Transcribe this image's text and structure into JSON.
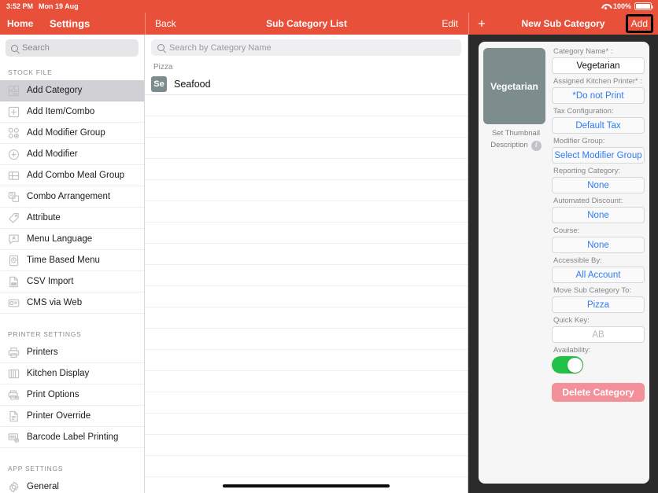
{
  "status": {
    "time": "3:52 PM",
    "date": "Mon 19 Aug",
    "battery_pct": "100%",
    "wifi_icon": "wifi-icon",
    "battery_icon": "battery-icon"
  },
  "nav": {
    "home": "Home",
    "settings": "Settings",
    "back": "Back",
    "list_title": "Sub Category List",
    "edit": "Edit",
    "detail_title": "New Sub Category",
    "add": "Add",
    "plus": "+",
    "accent": "#E8503A"
  },
  "sidebar": {
    "search_placeholder": "Search",
    "sections": [
      {
        "header": "STOCK FILE",
        "items": [
          {
            "label": "Add Category",
            "icon": "grid-add-icon",
            "selected": true
          },
          {
            "label": "Add Item/Combo",
            "icon": "plus-square-icon",
            "selected": false
          },
          {
            "label": "Add Modifier Group",
            "icon": "circles-add-icon",
            "selected": false
          },
          {
            "label": "Add Modifier",
            "icon": "plus-circle-icon",
            "selected": false
          },
          {
            "label": "Add Combo Meal Group",
            "icon": "stack-icon",
            "selected": false
          },
          {
            "label": "Combo Arrangement",
            "icon": "arrange-icon",
            "selected": false
          },
          {
            "label": "Attribute",
            "icon": "tag-icon",
            "selected": false
          },
          {
            "label": "Menu Language",
            "icon": "language-bubble-icon",
            "selected": false
          },
          {
            "label": "Time Based Menu",
            "icon": "clock-doc-icon",
            "selected": false
          },
          {
            "label": "CSV Import",
            "icon": "csv-file-icon",
            "selected": false
          },
          {
            "label": "CMS via Web",
            "icon": "id-card-icon",
            "selected": false
          }
        ]
      },
      {
        "header": "PRINTER SETTINGS",
        "items": [
          {
            "label": "Printers",
            "icon": "printer-icon",
            "selected": false
          },
          {
            "label": "Kitchen Display",
            "icon": "kds-icon",
            "selected": false
          },
          {
            "label": "Print Options",
            "icon": "print-options-icon",
            "selected": false
          },
          {
            "label": "Printer Override",
            "icon": "document-icon",
            "selected": false
          },
          {
            "label": "Barcode Label Printing",
            "icon": "barcode-icon",
            "selected": false
          }
        ]
      },
      {
        "header": "APP SETTINGS",
        "items": [
          {
            "label": "General",
            "icon": "gear-icon",
            "selected": false
          }
        ]
      }
    ]
  },
  "list_panel": {
    "search_placeholder": "Search by Category Name",
    "group_label": "Pizza",
    "rows": [
      {
        "badge": "Se",
        "name": "Seafood",
        "badge_color": "#7D8C8C"
      }
    ],
    "empty_row_count": 18
  },
  "detail": {
    "thumbnail_text": "Vegetarian",
    "thumbnail_color": "#7D8C8C",
    "set_thumbnail_label": "Set Thumbnail",
    "description_label": "Description",
    "info_glyph": "i",
    "fields": [
      {
        "label": "Category Name* :",
        "value": "Vegetarian",
        "style": "text"
      },
      {
        "label": "Assigned Kitchen Printer* :",
        "value": "*Do not Print",
        "style": "button"
      },
      {
        "label": "Tax Configuration:",
        "value": "Default Tax",
        "style": "button"
      },
      {
        "label": "Modifier Group:",
        "value": "Select Modifier Group",
        "style": "button"
      },
      {
        "label": "Reporting Category:",
        "value": "None",
        "style": "button"
      },
      {
        "label": "Automated Discount:",
        "value": "None",
        "style": "button"
      },
      {
        "label": "Course:",
        "value": "None",
        "style": "button"
      },
      {
        "label": "Accessible By:",
        "value": "All Account",
        "style": "button"
      },
      {
        "label": "Move Sub Category To:",
        "value": "Pizza",
        "style": "button"
      },
      {
        "label": "Quick Key:",
        "value": "AB",
        "style": "ghost"
      }
    ],
    "availability_label": "Availability:",
    "availability_on": true,
    "toggle_color": "#22C248",
    "delete_label": "Delete Category",
    "delete_color": "#F3909A"
  }
}
